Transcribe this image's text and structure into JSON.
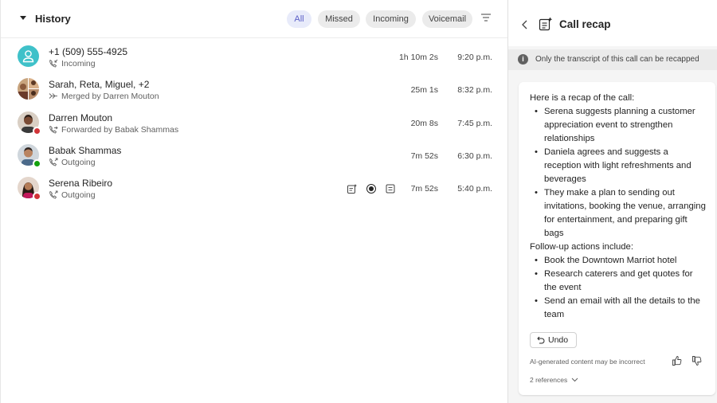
{
  "history": {
    "title": "History",
    "filters": [
      {
        "label": "All",
        "active": true
      },
      {
        "label": "Missed",
        "active": false
      },
      {
        "label": "Incoming",
        "active": false
      },
      {
        "label": "Voicemail",
        "active": false
      }
    ],
    "calls": [
      {
        "name": "+1 (509) 555-4925",
        "detail": "Incoming",
        "detail_icon": "incoming-call-icon",
        "duration": "1h 10m 2s",
        "time": "9:20 p.m.",
        "avatar": "generic-person-avatar",
        "status": "none"
      },
      {
        "name": "Sarah, Reta, Miguel, +2",
        "detail": "Merged by Darren Mouton",
        "detail_icon": "merge-arrow-icon",
        "duration": "25m 1s",
        "time": "8:32 p.m.",
        "avatar": "group-avatar",
        "status": "none"
      },
      {
        "name": "Darren Mouton",
        "detail": "Forwarded by Babak Shammas",
        "detail_icon": "forward-call-icon",
        "duration": "20m 8s",
        "time": "7:45 p.m.",
        "avatar": "darren-avatar",
        "status": "busy"
      },
      {
        "name": "Babak Shammas",
        "detail": "Outgoing",
        "detail_icon": "outgoing-call-icon",
        "duration": "7m 52s",
        "time": "6:30 p.m.",
        "avatar": "babak-avatar",
        "status": "available"
      },
      {
        "name": "Serena Ribeiro",
        "detail": "Outgoing",
        "detail_icon": "outgoing-call-icon",
        "duration": "7m 52s",
        "time": "5:40 p.m.",
        "avatar": "serena-avatar",
        "status": "busy"
      }
    ]
  },
  "recap": {
    "title": "Call recap",
    "banner": "Only the transcript of this call can be recapped",
    "intro": "Here is a recap of the call:",
    "points": [
      "Serena suggests planning a customer appreciation event to strengthen relationships",
      "Daniela agrees and suggests a reception with light refreshments and beverages",
      "They make a plan to sending out invitations, booking the venue, arranging for entertainment, and preparing gift bags"
    ],
    "followup_title": "Follow-up actions include:",
    "followups": [
      "Book the Downtown Marriot hotel",
      "Research caterers and get quotes for the event",
      "Send an email with all the details to the team"
    ],
    "undo_label": "Undo",
    "disclaimer": "AI-generated content may be incorrect",
    "references": "2 references"
  },
  "colors": {
    "accent": "#5b5fc7",
    "available": "#13a10e",
    "busy": "#d13438",
    "generic_avatar": "#3fc1c9"
  }
}
